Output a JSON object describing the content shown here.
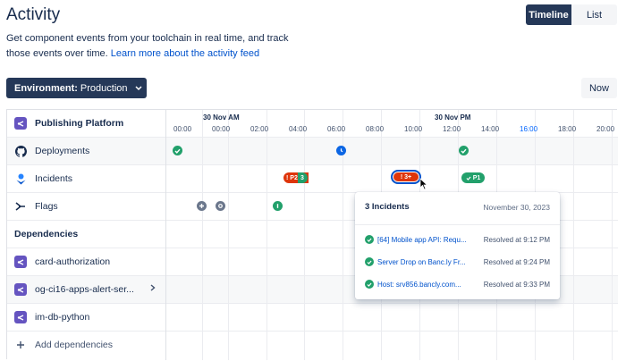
{
  "header": {
    "title": "Activity",
    "view_toggle": {
      "timeline": "Timeline",
      "list": "List"
    },
    "description": "Get component events from your toolchain in real time, and track those events over time.",
    "learn_more": "Learn more about the activity feed"
  },
  "toolbar": {
    "env_label": "Environment:",
    "env_value": "Production",
    "now_label": "Now"
  },
  "component": {
    "name": "Publishing Platform",
    "rows": [
      "Deployments",
      "Incidents",
      "Flags"
    ]
  },
  "dependencies": {
    "heading": "Dependencies",
    "items": [
      "card-authorization",
      "og-ci16-apps-alert-ser...",
      "im-db-python"
    ],
    "add_label": "Add dependencies"
  },
  "timeline": {
    "dates": [
      "30 Nov AM",
      "30 Nov PM"
    ],
    "ticks": [
      "00:00",
      "00:00",
      "02:00",
      "04:00",
      "06:00",
      "08:00",
      "10:00",
      "12:00",
      "14:00",
      "16:00",
      "18:00",
      "20:00"
    ],
    "incident_pills": {
      "p2": "! P2",
      "p2_count": "3",
      "selected": "! 3+",
      "p1": "P1"
    }
  },
  "popup": {
    "title": "3 Incidents",
    "date": "November 30, 2023",
    "items": [
      {
        "link": "[64] Mobile app API: Requ...",
        "resolved": "Resolved at 9:12 PM"
      },
      {
        "link": "Server Drop on Banc.ly Fr...",
        "resolved": "Resolved at 9:24 PM"
      },
      {
        "link": "Host: srv856.bancly.com...",
        "resolved": "Resolved at 9:33 PM"
      }
    ]
  },
  "colors": {
    "dark_navy": "#253858",
    "link_blue": "#0052cc",
    "success_green": "#22a06b",
    "danger_red": "#de350b",
    "component_purple": "#6554c0"
  }
}
